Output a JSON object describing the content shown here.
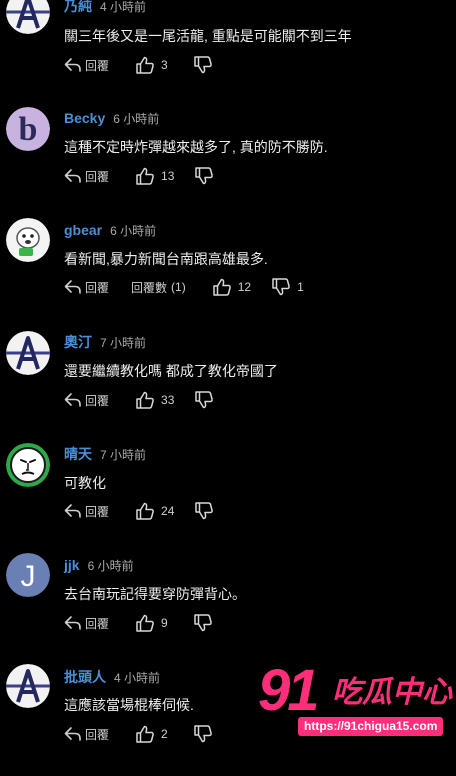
{
  "labels": {
    "reply": "回覆",
    "replies_prefix": "回覆數"
  },
  "comments": [
    {
      "name": "乃純",
      "time": "4 小時前",
      "text": "關三年後又是一尾活龍, 重點是可能關不到三年",
      "likes": "3",
      "avatar": "a-icon"
    },
    {
      "name": "Becky",
      "time": "6 小時前",
      "text": "這種不定時炸彈越來越多了, 真的防不勝防.",
      "likes": "13",
      "avatar": "b-letter-icon"
    },
    {
      "name": "gbear",
      "time": "6 小時前",
      "text": "看新聞,暴力新聞台南跟高雄最多.",
      "likes": "12",
      "replies": "(1)",
      "dislikes": "1",
      "avatar": "cartoon-dog-icon"
    },
    {
      "name": "奧汀",
      "time": "7 小時前",
      "text": "還要繼續教化嗎 都成了教化帝國了",
      "likes": "33",
      "avatar": "a-icon"
    },
    {
      "name": "晴天",
      "time": "7 小時前",
      "text": "可教化",
      "likes": "24",
      "avatar": "face-mask-icon"
    },
    {
      "name": "jjk",
      "time": "6 小時前",
      "text": "去台南玩記得要穿防彈背心。",
      "likes": "9",
      "avatar": "j-letter-icon"
    },
    {
      "name": "批頭人",
      "time": "4 小時前",
      "text": "這應該當場棍棒伺候.",
      "likes": "2",
      "avatar": "a-icon"
    }
  ],
  "watermark": {
    "number": "91",
    "name": "吃瓜中心",
    "url": "https://91chigua15.com"
  },
  "colors": {
    "username": "#4a8fd8",
    "background": "#000000",
    "watermark": "#ff2e7a"
  }
}
